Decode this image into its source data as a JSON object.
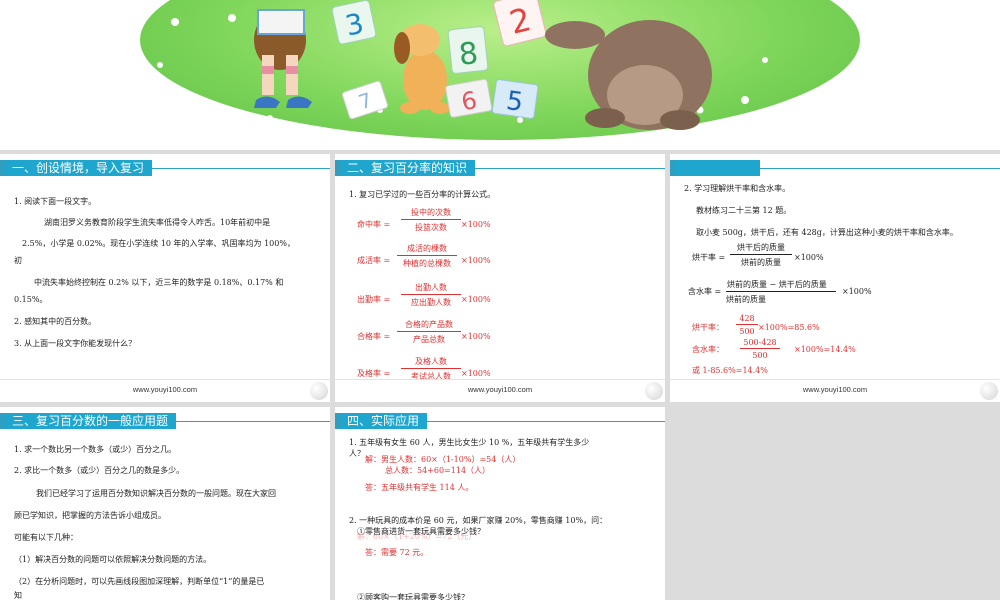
{
  "banner": {
    "cards": [
      "3",
      "8",
      "2",
      "6",
      "5",
      "7"
    ]
  },
  "slide1": {
    "title": "一、创设情境，导入复习",
    "lines": [
      "1. 阅读下面一段文字。",
      "湖南汨罗义务教育阶段学生流失率低得令人咋舌。10年前初中是",
      "2.5%，小学是 0.02%。现在小学连续 10 年的入学率、巩固率均为 100%，",
      "初",
      "中流失率始终控制在 0.2% 以下，近三年的数字是 0.18%、0.17% 和",
      "0.15%。",
      "2. 感知其中的百分数。",
      "3. 从上面一段文字你能发现什么？"
    ],
    "footer": "www.youyi100.com"
  },
  "slide2": {
    "title": "二、复习百分率的知识",
    "intro": "1. 复习已学过的一些百分率的计算公式。",
    "formulas": [
      {
        "label": "命中率 =",
        "num": "投中的次数",
        "den": "投篮次数",
        "tail": "×100%"
      },
      {
        "label": "成活率 =",
        "num": "成活的棵数",
        "den": "种植的总棵数",
        "tail": "×100%"
      },
      {
        "label": "出勤率 =",
        "num": "出勤人数",
        "den": "应出勤人数",
        "tail": "×100%"
      },
      {
        "label": "合格率 =",
        "num": "合格的产品数",
        "den": "产品总数",
        "tail": "×100%"
      },
      {
        "label": "及格率 =",
        "num": "及格人数",
        "den": "考试总人数",
        "tail": "×100%"
      }
    ],
    "footer": "www.youyi100.com"
  },
  "slide3": {
    "title": "",
    "line1": "2. 学习理解烘干率和含水率。",
    "line2": "教材练习二十三第 12 题。",
    "line3": "取小麦 500g，烘干后，还有 428g，计算出这种小麦的烘干率和含水率。",
    "f1": {
      "label": "烘干率 =",
      "num": "烘干后的质量",
      "den": "烘前的质量",
      "tail": "×100%"
    },
    "f2": {
      "label": "含水率 =",
      "num": "烘前的质量 − 烘干后的质量",
      "den": "烘前的质量",
      "tail": "×100%"
    },
    "a1": {
      "label": "烘干率：",
      "num": "428",
      "den": "500",
      "tail": "×100%=85.6%"
    },
    "a2": {
      "label": "含水率：",
      "num": "500-428",
      "den": "500",
      "tail": "×100%=14.4%"
    },
    "a3": "或 1-85.6%=14.4%",
    "footer": "www.youyi100.com"
  },
  "slide4": {
    "title": "三、复习百分数的一般应用题",
    "lines": [
      "1. 求一个数比另一个数多（或少）百分之几。",
      "2. 求比一个数多（或少）百分之几的数是多少。",
      "我们已经学习了运用百分数知识解决百分数的一般问题。现在大家回",
      "顾已学知识，把掌握的方法告诉小组成员。",
      "可能有以下几种：",
      "（1）解决百分数的问题可以依照解决分数问题的方法。",
      "（2）在分析问题时，可以先画线段图加深理解，判断单位“1”的量是已",
      "知"
    ]
  },
  "slide5": {
    "title": "四、实际应用",
    "q1": "1. 五年级有女生 60 人，男生比女生少 10 %，五年级共有学生多少",
    "q1b": "人？",
    "s1": "解：男生人数：60×（1-10%）=54（人）",
    "s2": "总人数：54+60=114（人）",
    "s3": "答：五年级共有学生 114 人。",
    "q2": "2. 一种玩具的成本价是 60 元，如果厂家赚 20%，零售商赚 10%，问：",
    "q2a": "①零售商进货一套玩具需要多少钱？",
    "q2a_ghost": "解：60×（1+20%）=72（元）",
    "q2a_ans": "答：需要 72 元。",
    "q2b": "②顾客购一套玩具需要多少钱？"
  }
}
